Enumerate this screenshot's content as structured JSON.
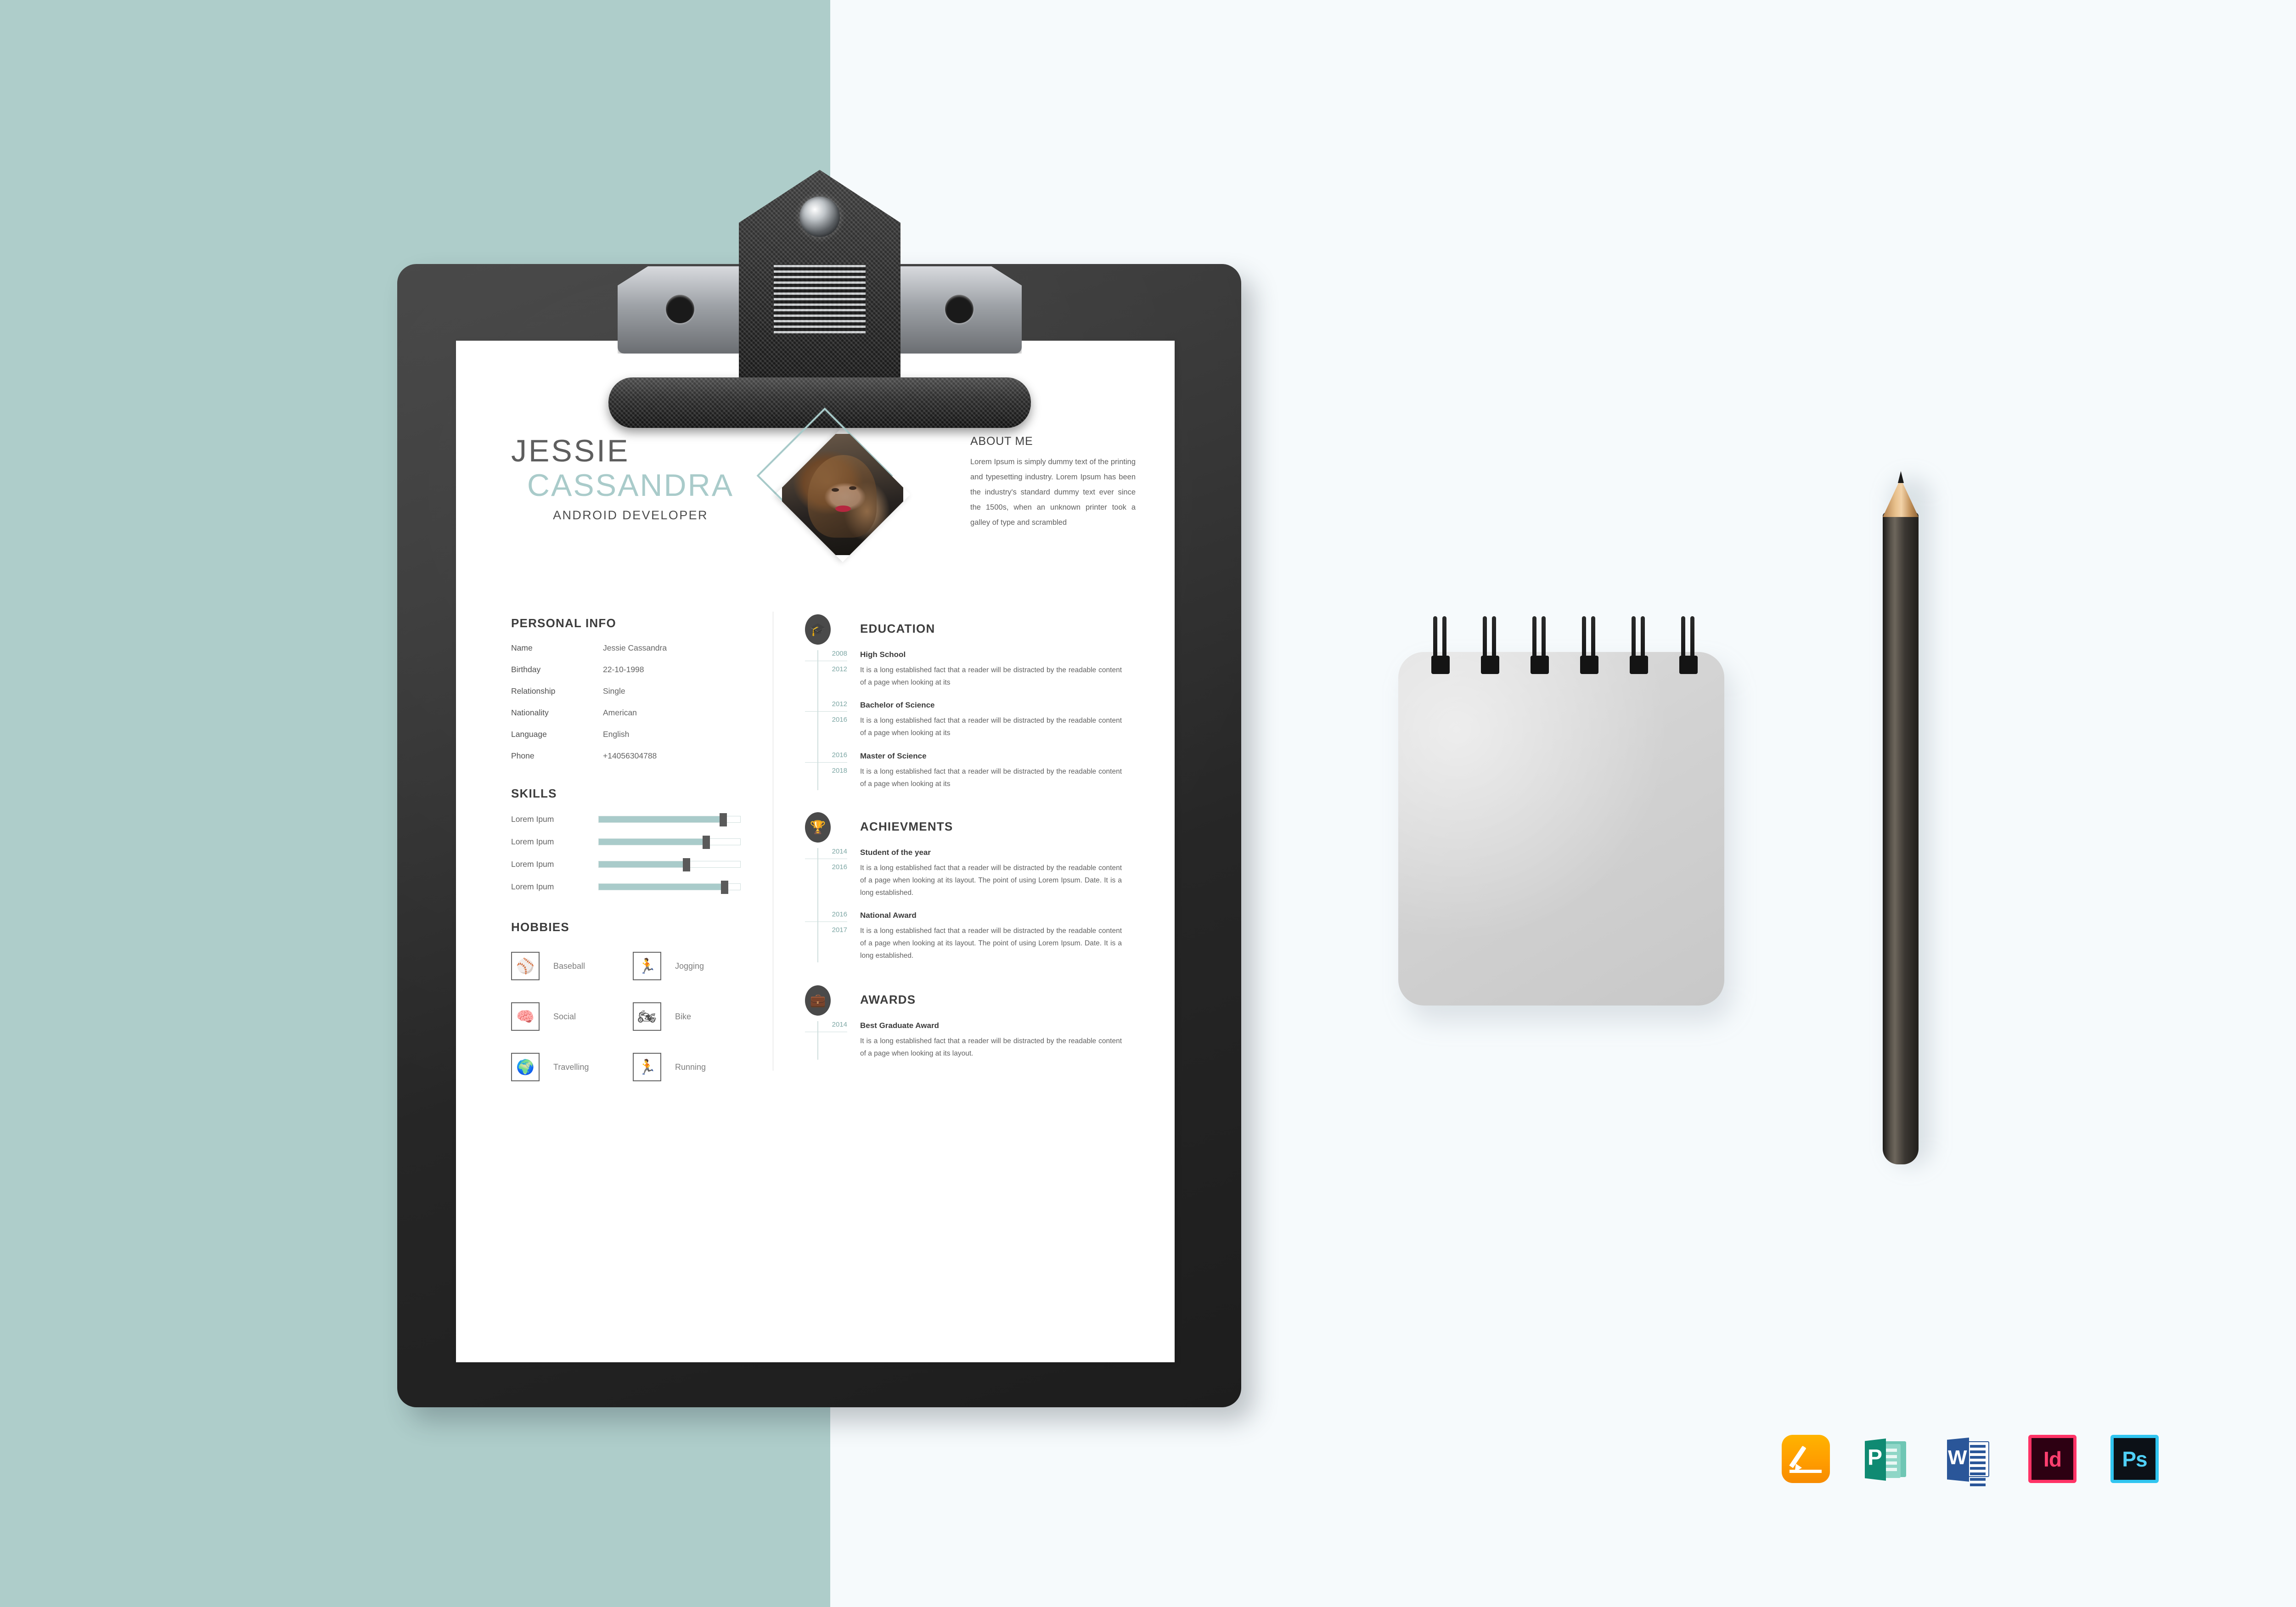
{
  "background": {
    "left_color": "#aecdca",
    "right_color": "#f6fafc"
  },
  "resume": {
    "first_name": "JESSIE",
    "last_name": "CASSANDRA",
    "job_title": "ANDROID DEVELOPER",
    "accent_color": "#a9cbca",
    "about": {
      "title": "ABOUT ME",
      "text": "Lorem Ipsum is simply dummy text of the printing and typesetting industry. Lorem Ipsum has been the industry's standard dummy text ever since the 1500s, when an unknown printer took a galley of type and scrambled"
    },
    "personal_info": {
      "title": "PERSONAL INFO",
      "rows": [
        {
          "label": "Name",
          "value": "Jessie Cassandra"
        },
        {
          "label": "Birthday",
          "value": "22-10-1998"
        },
        {
          "label": "Relationship",
          "value": "Single"
        },
        {
          "label": "Nationality",
          "value": "American"
        },
        {
          "label": "Language",
          "value": "English"
        },
        {
          "label": "Phone",
          "value": "+14056304788"
        }
      ]
    },
    "skills": {
      "title": "SKILLS",
      "items": [
        {
          "label": "Lorem Ipum",
          "percent": 88
        },
        {
          "label": "Lorem Ipum",
          "percent": 76
        },
        {
          "label": "Lorem Ipum",
          "percent": 62
        },
        {
          "label": "Lorem Ipum",
          "percent": 89
        }
      ]
    },
    "hobbies": {
      "title": "HOBBIES",
      "items": [
        {
          "label": "Baseball",
          "icon": "baseball-icon",
          "glyph": "⚾"
        },
        {
          "label": "Jogging",
          "icon": "running-person-icon",
          "glyph": "🏃"
        },
        {
          "label": "Social",
          "icon": "brain-icon",
          "glyph": "🧠"
        },
        {
          "label": "Bike",
          "icon": "motorbike-icon",
          "glyph": "🏍"
        },
        {
          "label": "Travelling",
          "icon": "globe-plane-icon",
          "glyph": "🌍"
        },
        {
          "label": "Running",
          "icon": "running-person-icon",
          "glyph": "🏃"
        }
      ]
    },
    "education": {
      "title": "EDUCATION",
      "icon": "graduation-cap-icon",
      "glyph": "🎓",
      "items": [
        {
          "year_start": "2008",
          "year_end": "2012",
          "title": "High School",
          "desc": "It is a long established fact that a reader will be distracted by the readable content of a page when looking at its"
        },
        {
          "year_start": "2012",
          "year_end": "2016",
          "title": "Bachelor of Science",
          "desc": "It is a long established fact that a reader will be distracted by the readable content of a page when looking at its"
        },
        {
          "year_start": "2016",
          "year_end": "2018",
          "title": "Master of Science",
          "desc": "It is a long established fact that a reader will be distracted by the readable content of a page when looking at its"
        }
      ]
    },
    "achievements": {
      "title": "ACHIEVMENTS",
      "icon": "trophy-icon",
      "glyph": "🏆",
      "items": [
        {
          "year_start": "2014",
          "year_end": "2016",
          "title": "Student of the year",
          "desc": "It is a long established fact that a reader will be distracted by the readable content of a page when looking at its layout. The point of using Lorem Ipsum. Date. It is a long established."
        },
        {
          "year_start": "2016",
          "year_end": "2017",
          "title": "National Award",
          "desc": "It is a long established fact that a reader will be distracted by the readable content of a page when looking at its layout. The point of using Lorem Ipsum. Date. It is a long established."
        }
      ]
    },
    "awards": {
      "title": "AWARDS",
      "icon": "briefcase-icon",
      "glyph": "💼",
      "items": [
        {
          "year_start": "2014",
          "year_end": "",
          "title": "Best Graduate Award",
          "desc": "It is a long established fact that a reader will be distracted by the readable content of a page when looking at its layout."
        }
      ]
    }
  },
  "format_icons": [
    {
      "name": "apple-pages-icon",
      "label": "Pages"
    },
    {
      "name": "microsoft-publisher-icon",
      "label": "P"
    },
    {
      "name": "microsoft-word-icon",
      "label": "W"
    },
    {
      "name": "adobe-indesign-icon",
      "label": "Id"
    },
    {
      "name": "adobe-photoshop-icon",
      "label": "Ps"
    }
  ],
  "props": {
    "notepad": "spiral-notepad",
    "pencil": "pencil",
    "clipboard": "clipboard"
  }
}
